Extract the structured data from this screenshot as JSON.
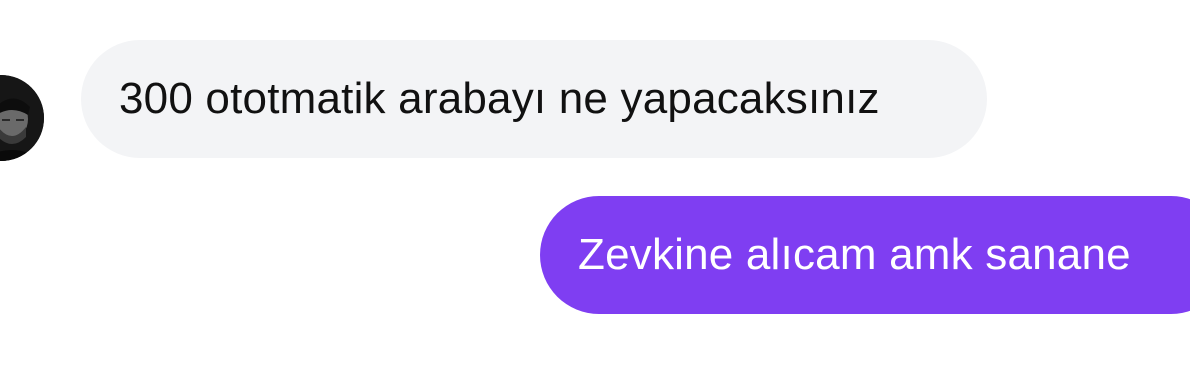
{
  "conversation": {
    "messages": [
      {
        "sender": "them",
        "text": "300 ototmatik arabayı ne yapacaksınız"
      },
      {
        "sender": "me",
        "text": "Zevkine alıcam amk sanane"
      }
    ]
  },
  "colors": {
    "incoming_bubble": "#f3f4f6",
    "incoming_text": "#111111",
    "outgoing_bubble": "#7f3ef2",
    "outgoing_text": "#ffffff"
  }
}
